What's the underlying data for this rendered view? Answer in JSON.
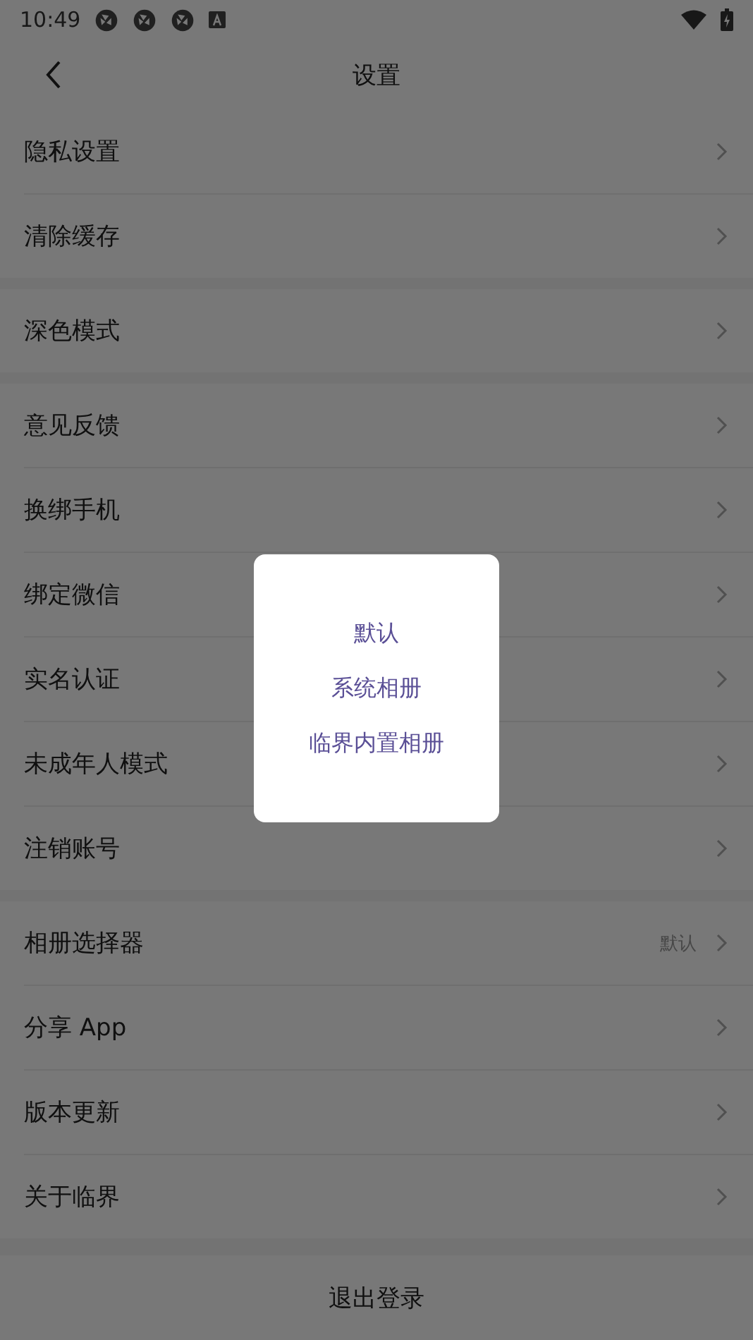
{
  "status_bar": {
    "time": "10:49"
  },
  "header": {
    "title": "设置"
  },
  "sections": [
    {
      "items": [
        {
          "label": "隐私设置"
        },
        {
          "label": "清除缓存"
        }
      ]
    },
    {
      "items": [
        {
          "label": "深色模式"
        }
      ]
    },
    {
      "items": [
        {
          "label": "意见反馈"
        },
        {
          "label": "换绑手机"
        },
        {
          "label": "绑定微信"
        },
        {
          "label": "实名认证"
        },
        {
          "label": "未成年人模式"
        },
        {
          "label": "注销账号"
        }
      ]
    },
    {
      "items": [
        {
          "label": "相册选择器",
          "value": "默认"
        },
        {
          "label": "分享 App"
        },
        {
          "label": "版本更新"
        },
        {
          "label": "关于临界"
        }
      ]
    }
  ],
  "logout_button": "退出登录",
  "dialog": {
    "options": [
      "默认",
      "系统相册",
      "临界内置相册"
    ]
  }
}
